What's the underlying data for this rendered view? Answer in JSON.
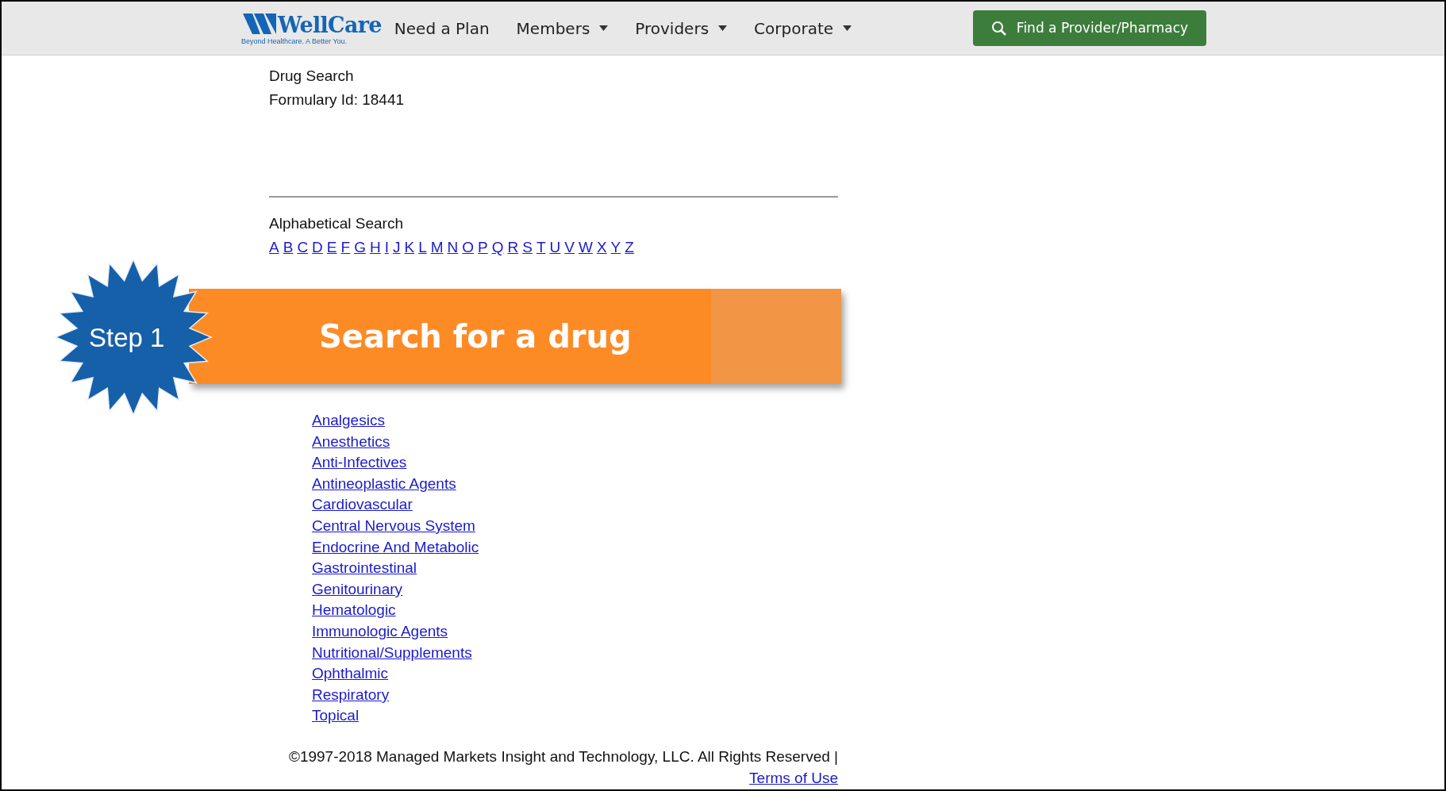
{
  "header": {
    "logo": {
      "name": "WellCare",
      "tagline": "Beyond Healthcare. A Better You."
    },
    "nav": [
      {
        "label": "Need a Plan",
        "dropdown": false
      },
      {
        "label": "Members",
        "dropdown": true
      },
      {
        "label": "Providers",
        "dropdown": true
      },
      {
        "label": "Corporate",
        "dropdown": true
      }
    ],
    "action_button": "Find a Provider/Pharmacy"
  },
  "page": {
    "title": "Drug Search",
    "formulary": "Formulary Id: 18441",
    "alphabetical": {
      "heading": "Alphabetical Search",
      "letters": [
        "A",
        "B",
        "C",
        "D",
        "E",
        "F",
        "G",
        "H",
        "I",
        "J",
        "K",
        "L",
        "M",
        "N",
        "O",
        "P",
        "Q",
        "R",
        "S",
        "T",
        "U",
        "V",
        "W",
        "X",
        "Y",
        "Z"
      ]
    },
    "classes": [
      "Analgesics",
      "Anesthetics",
      "Anti-Infectives",
      "Antineoplastic Agents",
      "Cardiovascular",
      "Central Nervous System",
      "Endocrine And Metabolic",
      "Gastrointestinal",
      "Genitourinary",
      "Hematologic",
      "Immunologic Agents",
      "Nutritional/Supplements",
      "Ophthalmic",
      "Respiratory",
      "Topical"
    ],
    "footer": {
      "copyright": "©1997-2018 Managed Markets Insight and Technology, LLC. All Rights Reserved |",
      "link": "Terms of Use"
    }
  },
  "callout": {
    "step": "Step 1",
    "text": "Search for a drug"
  }
}
